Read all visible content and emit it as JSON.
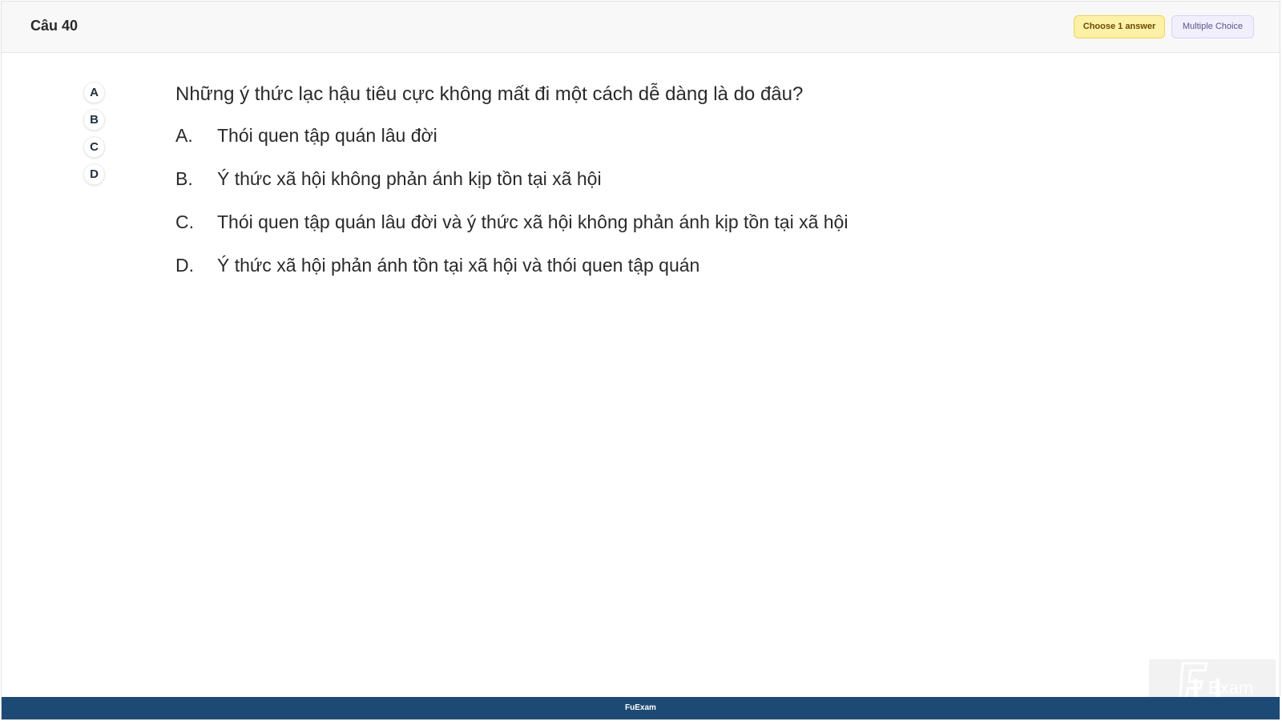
{
  "header": {
    "question_title": "Câu 40",
    "choose_badge": "Choose 1 answer",
    "type_badge": "Multiple Choice"
  },
  "side_answers": [
    "A",
    "B",
    "C",
    "D"
  ],
  "question": {
    "text": "Những ý thức lạc hậu tiêu cực không mất đi một cách dễ dàng là do đâu?",
    "options": [
      {
        "letter": "A.",
        "text": "Thói quen tập quán lâu đời"
      },
      {
        "letter": "B.",
        "text": "Ý thức xã hội không phản ánh kịp tồn tại xã hội"
      },
      {
        "letter": "C.",
        "text": "Thói quen tập quán lâu đời và ý thức xã hội không phản ánh kịp tồn tại xã hội"
      },
      {
        "letter": "D.",
        "text": "Ý thức xã hội phản ánh tồn tại xã hội và thói quen tập quán"
      }
    ]
  },
  "footer": {
    "brand": "FuExam"
  },
  "watermark": {
    "text": "Exam"
  },
  "colors": {
    "footer_bg": "#1d4a74",
    "choose_badge_bg": "#fdf1a8",
    "type_badge_bg": "#f1effc"
  }
}
